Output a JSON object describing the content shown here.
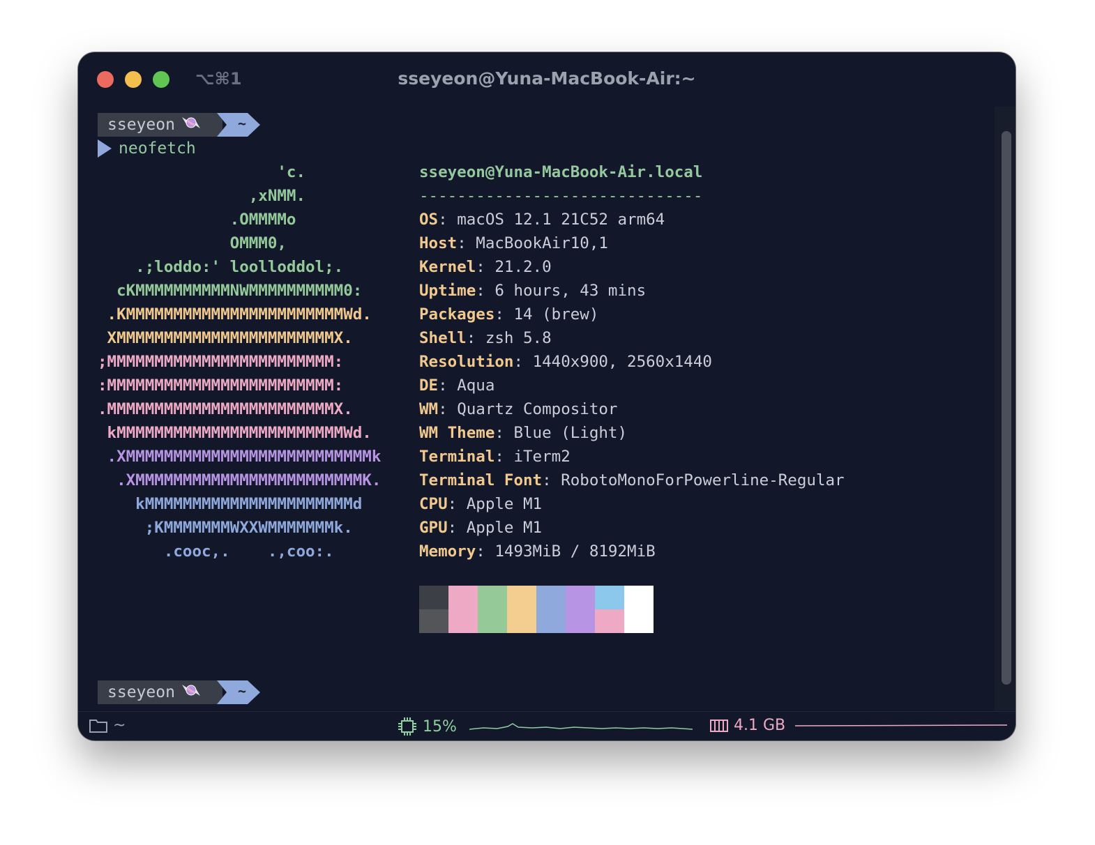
{
  "window": {
    "shortcut": "⌥⌘1",
    "title": "sseyeon@Yuna-MacBook-Air:~"
  },
  "prompt": {
    "user": "sseyeon",
    "user_icon": "candy-icon",
    "path": "~",
    "command": "neofetch"
  },
  "logo_lines": [
    {
      "text": "                   'c.",
      "color": "green"
    },
    {
      "text": "                ,xNMM.",
      "color": "green"
    },
    {
      "text": "              .OMMMMo",
      "color": "green"
    },
    {
      "text": "              OMMM0,",
      "color": "green"
    },
    {
      "text": "    .;loddo:' loolloddol;.",
      "color": "green"
    },
    {
      "text": "  cKMMMMMMMMMMNWMMMMMMMMMM0:",
      "color": "green"
    },
    {
      "text": " .KMMMMMMMMMMMMMMMMMMMMMMMWd.",
      "color": "yellow"
    },
    {
      "text": " XMMMMMMMMMMMMMMMMMMMMMMMX.",
      "color": "yellow"
    },
    {
      "text": ";MMMMMMMMMMMMMMMMMMMMMMMM:",
      "color": "pink"
    },
    {
      "text": ":MMMMMMMMMMMMMMMMMMMMMMMM:",
      "color": "pink"
    },
    {
      "text": ".MMMMMMMMMMMMMMMMMMMMMMMMX.",
      "color": "pink"
    },
    {
      "text": " kMMMMMMMMMMMMMMMMMMMMMMMMWd.",
      "color": "pink"
    },
    {
      "text": " .XMMMMMMMMMMMMMMMMMMMMMMMMMMk",
      "color": "violet"
    },
    {
      "text": "  .XMMMMMMMMMMMMMMMMMMMMMMMMK.",
      "color": "violet"
    },
    {
      "text": "    kMMMMMMMMMMMMMMMMMMMMMMd",
      "color": "blue"
    },
    {
      "text": "     ;KMMMMMMMWXXWMMMMMMMk.",
      "color": "blue"
    },
    {
      "text": "       .cooc,.    .,coo:.",
      "color": "blue"
    }
  ],
  "info": {
    "host": "sseyeon@Yuna-MacBook-Air.local",
    "separator": "------------------------------",
    "fields": [
      {
        "key": "OS",
        "value": "macOS 12.1 21C52 arm64"
      },
      {
        "key": "Host",
        "value": "MacBookAir10,1"
      },
      {
        "key": "Kernel",
        "value": "21.2.0"
      },
      {
        "key": "Uptime",
        "value": "6 hours, 43 mins"
      },
      {
        "key": "Packages",
        "value": "14 (brew)"
      },
      {
        "key": "Shell",
        "value": "zsh 5.8"
      },
      {
        "key": "Resolution",
        "value": "1440x900, 2560x1440"
      },
      {
        "key": "DE",
        "value": "Aqua"
      },
      {
        "key": "WM",
        "value": "Quartz Compositor"
      },
      {
        "key": "WM Theme",
        "value": "Blue (Light)"
      },
      {
        "key": "Terminal",
        "value": "iTerm2"
      },
      {
        "key": "Terminal Font",
        "value": "RobotoMonoForPowerline-Regular"
      },
      {
        "key": "CPU",
        "value": "Apple M1"
      },
      {
        "key": "GPU",
        "value": "Apple M1"
      },
      {
        "key": "Memory",
        "value": "1493MiB / 8192MiB"
      }
    ]
  },
  "palette": {
    "top": [
      "#3c3f46",
      "#eea9c4",
      "#95c997",
      "#f4cd91",
      "#8fa9dd",
      "#b895e4",
      "#8cc8ec",
      "#ffffff"
    ],
    "bottom": [
      "#535558",
      "#eea9c4",
      "#95c997",
      "#f4cd91",
      "#8fa9dd",
      "#b895e4",
      "#eea9c4",
      "#ffffff"
    ]
  },
  "status": {
    "path": "~",
    "cpu": "15%",
    "memory": "4.1 GB"
  },
  "colors": {
    "green": "#94c99a",
    "yellow": "#f1c98e",
    "pink": "#eea9c4",
    "violet": "#b895e4",
    "blue": "#8fa9dd",
    "background": "#121829",
    "accent": "#8fa9dd"
  }
}
